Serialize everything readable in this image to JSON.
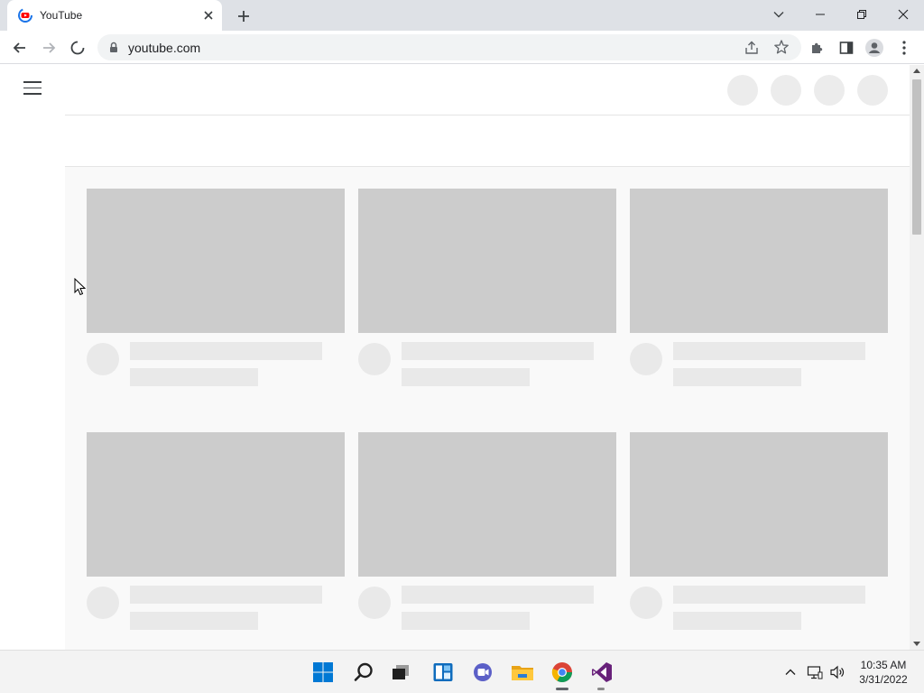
{
  "browser": {
    "tab": {
      "title": "YouTube",
      "favicon": "youtube-favicon-icon"
    },
    "omnibox": {
      "url": "youtube.com"
    },
    "accent": "#1a73e8"
  },
  "page": {
    "state": "loading",
    "skeleton_color": "#cccccc"
  },
  "taskbar": {
    "apps": [
      "start",
      "search",
      "task-view",
      "widgets",
      "teams-chat",
      "file-explorer",
      "chrome",
      "visual-studio"
    ],
    "clock": {
      "time": "10:35 AM",
      "date": "3/31/2022"
    }
  }
}
